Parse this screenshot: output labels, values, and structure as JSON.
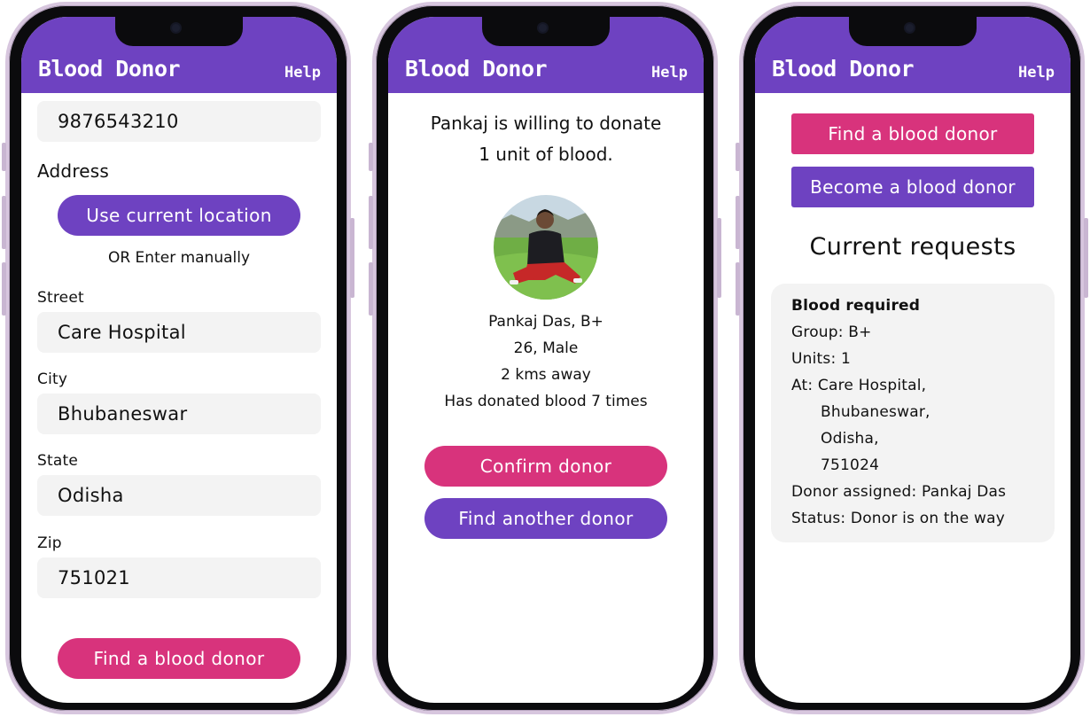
{
  "app": {
    "title": "Blood Donor",
    "help": "Help",
    "colors": {
      "primary": "#6e42c1",
      "accent": "#d8337c",
      "field": "#f3f3f3"
    }
  },
  "screen1": {
    "phone_value": "9876543210",
    "address_label": "Address",
    "use_location_button": "Use current location",
    "or_text": "OR Enter manually",
    "street_label": "Street",
    "street_value": "Care Hospital",
    "city_label": "City",
    "city_value": "Bhubaneswar",
    "state_label": "State",
    "state_value": "Odisha",
    "zip_label": "Zip",
    "zip_value": "751021",
    "find_button": "Find a blood donor"
  },
  "screen2": {
    "message_line1": "Pankaj is willing to donate",
    "message_line2": "1 unit of blood.",
    "avatar_icon": "donor-photo",
    "donor_name": "Pankaj Das, B+",
    "donor_age_gender": "26, Male",
    "donor_distance": "2 kms away",
    "donor_history": "Has donated blood 7 times",
    "confirm_button": "Confirm donor",
    "find_another_button": "Find another donor"
  },
  "screen3": {
    "find_button": "Find a blood donor",
    "become_button": "Become a blood donor",
    "section_title": "Current requests",
    "request": {
      "heading": "Blood required",
      "group": "Group: B+",
      "units": "Units: 1",
      "at_line1": "At: Care Hospital,",
      "at_line2": "Bhubaneswar,",
      "at_line3": "Odisha,",
      "at_line4": "751024",
      "donor": "Donor assigned: Pankaj Das",
      "status": "Status: Donor is on the way"
    }
  }
}
